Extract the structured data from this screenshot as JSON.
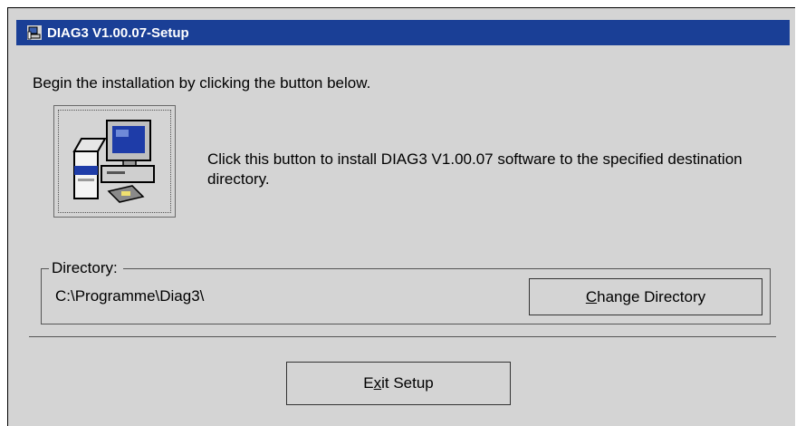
{
  "window": {
    "title": "DIAG3 V1.00.07-Setup",
    "title_bar_color": "#1a3f96",
    "background_color": "#d4d4d4",
    "icon": "setup-app-icon"
  },
  "main": {
    "intro_text": "Begin the installation by clicking the button below.",
    "install_button_icon": "computer-install-icon",
    "install_description": "Click this button to install DIAG3 V1.00.07 software to the specified destination directory."
  },
  "directory": {
    "group_label": "Directory:",
    "path": "C:\\Programme\\Diag3\\",
    "change_button": {
      "mnemonic": "C",
      "rest": "hange Directory"
    }
  },
  "footer": {
    "exit_button": {
      "before": "E",
      "mnemonic": "x",
      "rest": "it Setup"
    }
  }
}
